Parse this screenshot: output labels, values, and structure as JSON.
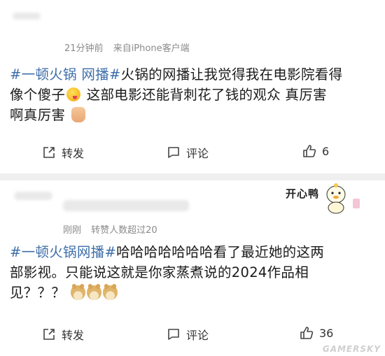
{
  "posts": [
    {
      "meta": {
        "time": "21分钟前",
        "source": "来自iPhone客户端"
      },
      "text": {
        "line1_topic": "#一顿火锅 网播#",
        "line1_rest": "火锅的网播让我觉得我在电影院看得",
        "line2_a": "像个傻子",
        "line2_b": " 这部电影还能背刺花了钱的观众 真厉害",
        "line3": "啊真厉害"
      },
      "actions": {
        "repost": "转发",
        "comment": "评论",
        "likes": "6"
      }
    },
    {
      "meta": {
        "time": "刚刚",
        "info": "转赞人数超过20"
      },
      "sticker": "开心鸭",
      "text": {
        "line1_topic": "#一顿火锅网播#",
        "line1_rest": "哈哈哈哈哈哈哈看了最近她的这两",
        "line2": "部影视。只能说这就是你家蒸煮说的2024作品相",
        "line3": "见？？？"
      },
      "actions": {
        "repost": "转发",
        "comment": "评论",
        "likes": "36"
      }
    }
  ],
  "watermark": "GAMERSKY",
  "colors": {
    "topic": "#3d6ea8",
    "meta": "#8a8a8a",
    "divider": "#efefef"
  },
  "icons": [
    "repost-icon",
    "comment-icon",
    "like-icon",
    "wink-emoji-icon",
    "thumbs-up-emoji-icon",
    "doge-emoji-icon"
  ]
}
